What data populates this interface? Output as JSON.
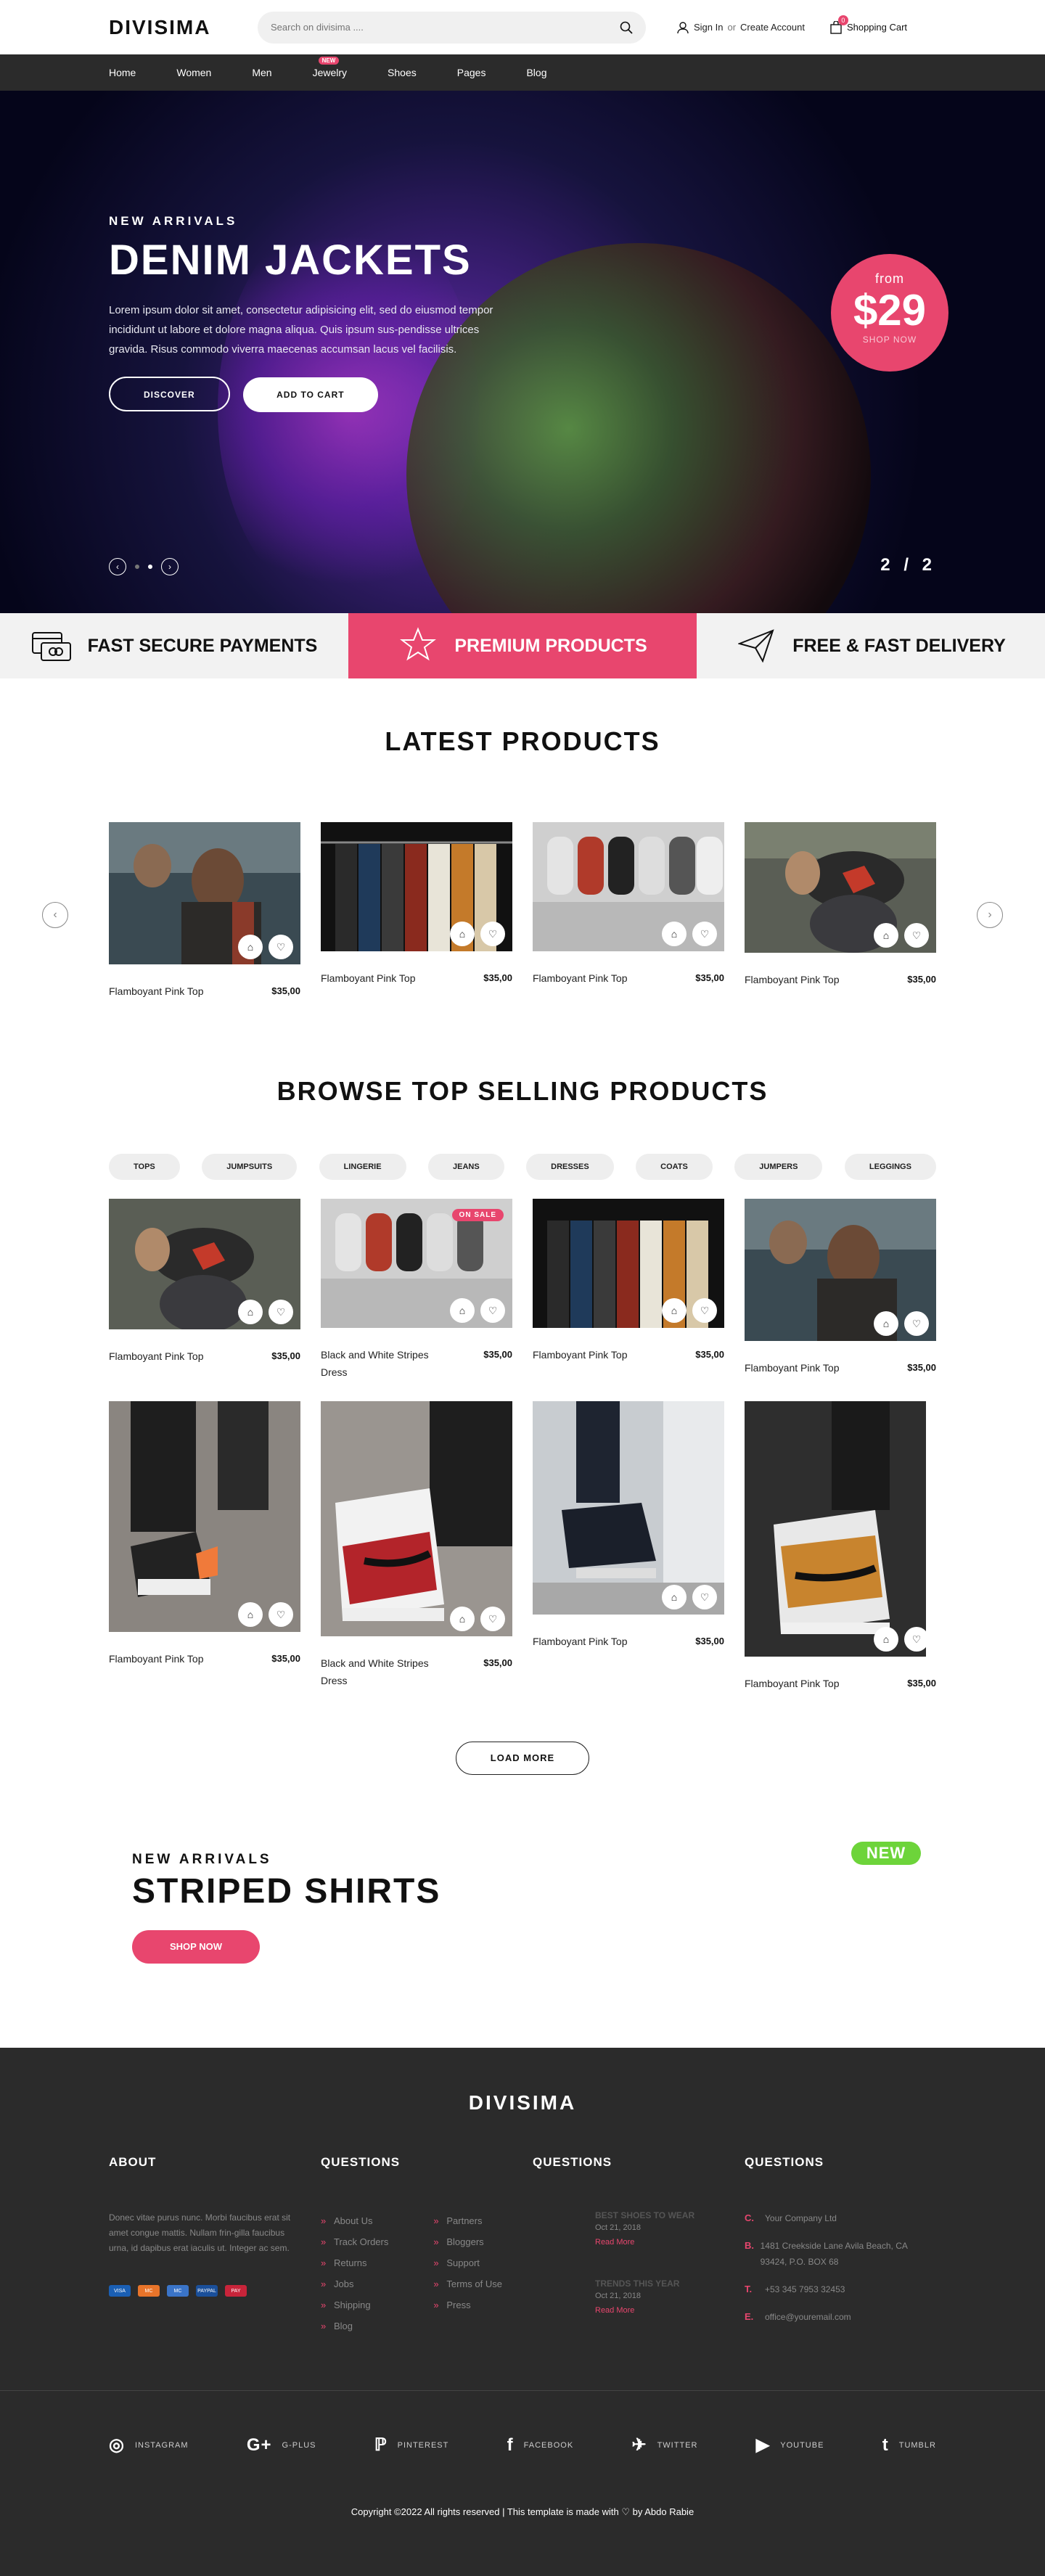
{
  "header": {
    "logo": "DIVISIMA",
    "search_placeholder": "Search on divisima ....",
    "account_signin": "Sign In",
    "account_or": "or",
    "account_create": "Create Account",
    "cart_label": "Shopping Cart",
    "cart_count": "0"
  },
  "nav": {
    "items": [
      "Home",
      "Women",
      "Men",
      "Jewelry",
      "Shoes",
      "Pages",
      "Blog"
    ],
    "new_badge": "NEW"
  },
  "hero": {
    "eyebrow": "NEW ARRIVALS",
    "title": "DENIM JACKETS",
    "text": "Lorem ipsum dolor sit amet, consectetur adipisicing elit, sed do eiusmod tempor incididunt ut labore et dolore magna aliqua. Quis ipsum sus-pendisse ultrices gravida. Risus commodo viverra maecenas accumsan lacus vel facilisis.",
    "btn_discover": "DISCOVER",
    "btn_add_cart": "ADD TO CART",
    "price_from": "from",
    "price_value": "$29",
    "price_link": "SHOP NOW",
    "counter": "2 / 2"
  },
  "features": [
    "FAST SECURE PAYMENTS",
    "PREMIUM PRODUCTS",
    "FREE & FAST DELIVERY"
  ],
  "latest": {
    "title": "LATEST PRODUCTS",
    "products": [
      {
        "name": "Flamboyant Pink Top",
        "price": "$35,00"
      },
      {
        "name": "Flamboyant Pink Top",
        "price": "$35,00"
      },
      {
        "name": "Flamboyant Pink Top",
        "price": "$35,00"
      },
      {
        "name": "Flamboyant Pink Top",
        "price": "$35,00"
      }
    ]
  },
  "browse": {
    "title": "BROWSE TOP SELLING PRODUCTS",
    "categories": [
      "TOPS",
      "JUMPSUITS",
      "LINGERIE",
      "JEANS",
      "DRESSES",
      "COATS",
      "JUMPERS",
      "LEGGINGS"
    ],
    "sale_badge": "ON SALE",
    "products": [
      {
        "name": "Flamboyant Pink Top",
        "price": "$35,00"
      },
      {
        "name": "Black and White Stripes Dress",
        "price": "$35,00"
      },
      {
        "name": "Flamboyant Pink Top",
        "price": "$35,00"
      },
      {
        "name": "Flamboyant Pink Top",
        "price": "$35,00"
      },
      {
        "name": "Flamboyant Pink Top",
        "price": "$35,00"
      },
      {
        "name": "Black and White Stripes Dress",
        "price": "$35,00"
      },
      {
        "name": "Flamboyant Pink Top",
        "price": "$35,00"
      },
      {
        "name": "Flamboyant Pink Top",
        "price": "$35,00"
      }
    ],
    "load_more": "LOAD MORE"
  },
  "promo": {
    "eyebrow": "NEW ARRIVALS",
    "title": "STRIPED SHIRTS",
    "button": "SHOP NOW",
    "badge": "NEW"
  },
  "footer": {
    "logo": "DIVISIMA",
    "about_title": "ABOUT",
    "about_text": "Donec vitae purus nunc. Morbi faucibus erat sit amet congue mattis. Nullam frin-gilla faucibus urna, id dapibus erat iaculis ut. Integer ac sem.",
    "q1_title": "QUESTIONS",
    "links_a": [
      "About Us",
      "Track Orders",
      "Returns",
      "Jobs",
      "Shipping",
      "Blog"
    ],
    "links_b": [
      "Partners",
      "Bloggers",
      "Support",
      "Terms of Use",
      "Press"
    ],
    "q2_title": "QUESTIONS",
    "posts": [
      {
        "title": "BEST SHOES TO WEAR",
        "date": "Oct 21, 2018",
        "read": "Read More"
      },
      {
        "title": "TRENDS THIS YEAR",
        "date": "Oct 21, 2018",
        "read": "Read More"
      }
    ],
    "q3_title": "QUESTIONS",
    "contact": [
      {
        "k": "C.",
        "v": "Your Company Ltd"
      },
      {
        "k": "B.",
        "v": "1481 Creekside Lane Avila Beach, CA 93424, P.O. BOX 68"
      },
      {
        "k": "T.",
        "v": "+53 345 7953 32453"
      },
      {
        "k": "E.",
        "v": "office@youremail.com"
      }
    ],
    "pay": [
      "VISA",
      "MC",
      "MC",
      "PAYPAL",
      "PAY"
    ],
    "socials": [
      "INSTAGRAM",
      "G-PLUS",
      "PINTEREST",
      "FACEBOOK",
      "TWITTER",
      "YOUTUBE",
      "TUMBLR"
    ],
    "copyright": "Copyright ©2022 All rights reserved | This template is made with ♡ by Abdo Rabie"
  },
  "colors": {
    "accent": "#e8466e",
    "dark": "#2b2b2b",
    "new_green": "#6dd43a"
  }
}
